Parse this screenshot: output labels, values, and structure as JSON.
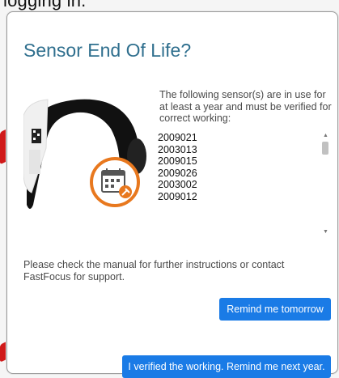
{
  "background": {
    "text": "logging in."
  },
  "dialog": {
    "title": "Sensor End Of Life?",
    "intro": "The following sensor(s) are in use for at least a year and must be verified for correct working:",
    "sensors": [
      "2009021",
      "2003013",
      "2009015",
      "2009026",
      "2003002",
      "2009012"
    ],
    "footer": "Please check the manual for further instructions or contact FastFocus for support.",
    "buttons": {
      "remind_tomorrow": "Remind me tomorrow",
      "verified": "I verified the working. Remind me next year."
    }
  },
  "colors": {
    "title": "#2f6f8e",
    "button": "#1a7be6",
    "accent": "#e8781e"
  }
}
